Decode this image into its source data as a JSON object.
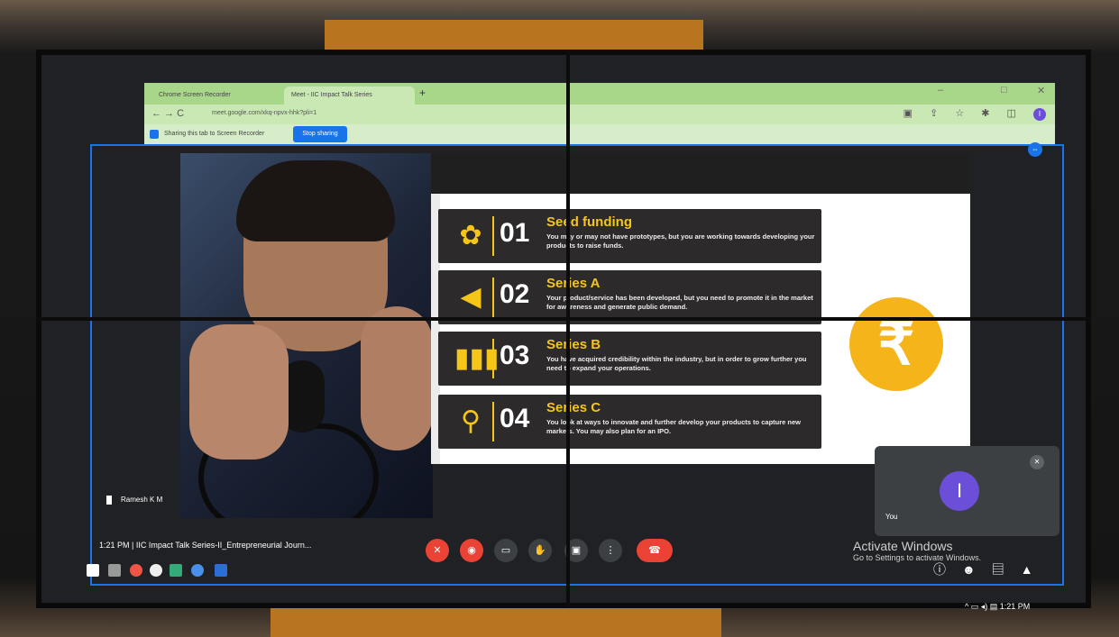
{
  "browser": {
    "tab_inactive": "Chrome Screen Recorder",
    "tab_active": "Meet - IIC Impact Talk Series",
    "new_tab_symbol": "+",
    "url": "meet.google.com/xkq-npvx-hhk?pli=1",
    "nav_symbols": "← → C",
    "toolbar_right_symbols": "▣ ⇪ ☆ ✱ ◫",
    "profile_initial": "I",
    "share_text": "Sharing this tab to Screen Recorder",
    "stop_sharing": "Stop sharing"
  },
  "slide": {
    "rows": [
      {
        "num": "01",
        "title": "Seed funding",
        "desc": "You may or may not have prototypes, but you are working towards developing your products to raise funds.",
        "icon": "flower-icon"
      },
      {
        "num": "02",
        "title": "Series A",
        "desc": "Your product/service has been developed, but you need to promote it in the market for awareness and generate public demand.",
        "icon": "megaphone-icon"
      },
      {
        "num": "03",
        "title": "Series B",
        "desc": "You have acquired credibility within the industry, but in order to grow further you need to expand your operations.",
        "icon": "bar-chart-icon"
      },
      {
        "num": "04",
        "title": "Series C",
        "desc": "You look at ways to innovate and further develop your products to capture new markets. You may also plan for an IPO.",
        "icon": "search-icon"
      }
    ],
    "currency_symbol": "₹"
  },
  "meet": {
    "presenter_name": "Ramesh K M",
    "self_label": "You",
    "self_initial": "I",
    "time": "1:21 PM",
    "separator": "|",
    "meeting_title": "IIC Impact Talk Series-II_Entrepreneurial Journ..."
  },
  "windows": {
    "activate_title": "Activate Windows",
    "activate_sub": "Go to Settings to activate Windows.",
    "tray_time": "1:21 PM"
  },
  "colors": {
    "meet_blue": "#1a73e8",
    "slide_yellow": "#f5c518",
    "end_call_red": "#ea4335",
    "browser_green": "#a8d78a"
  }
}
